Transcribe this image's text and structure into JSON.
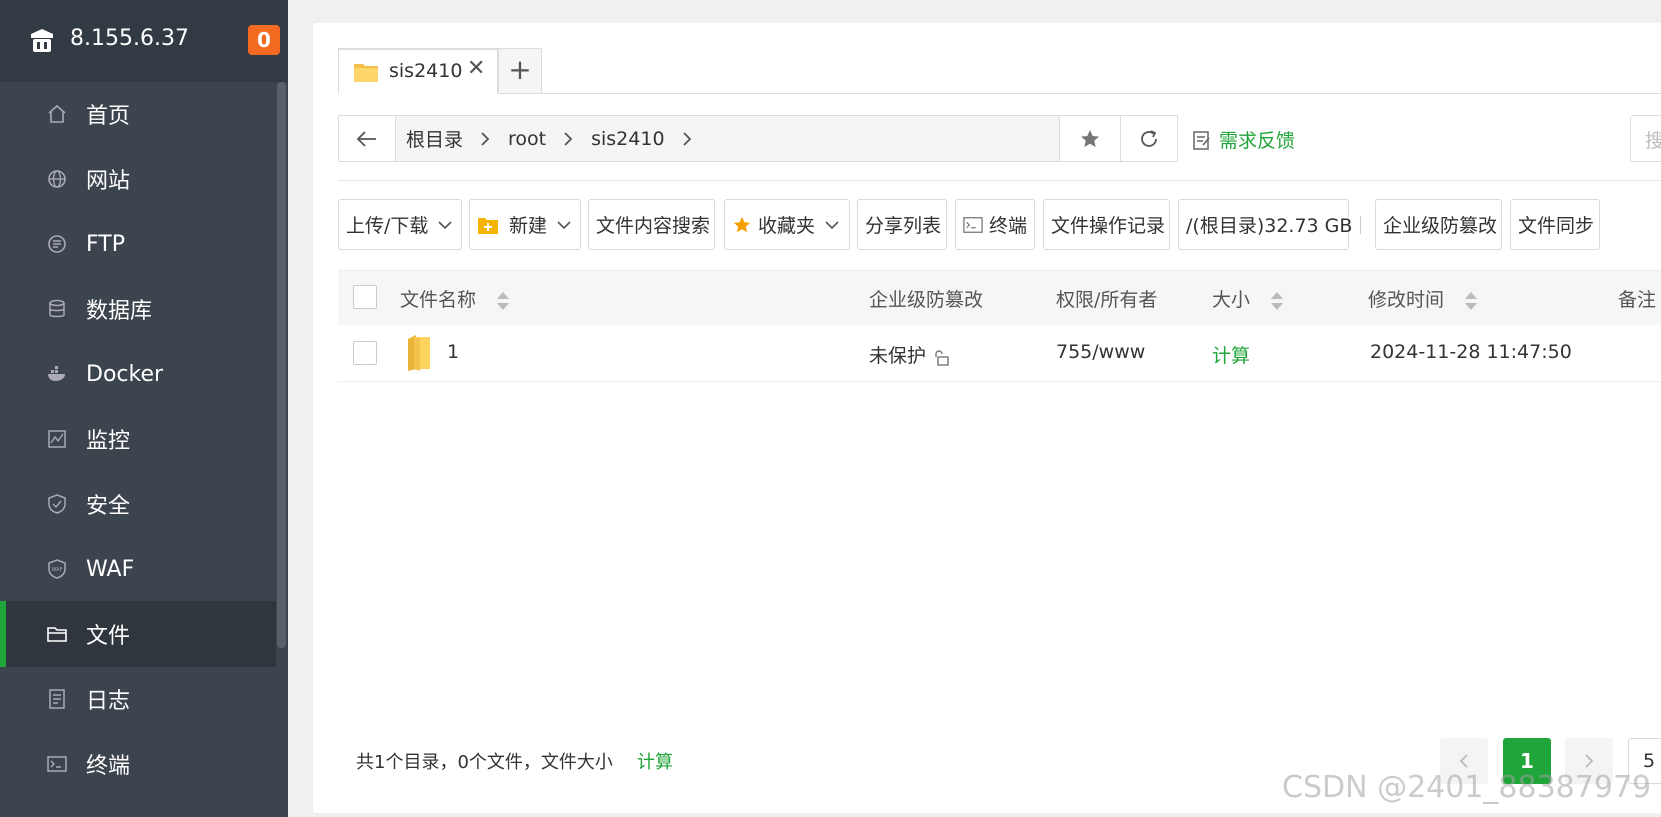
{
  "sidebar": {
    "server_ip": "8.155.6.37",
    "badge_count": "0",
    "items": [
      {
        "label": "首页",
        "icon": "home-icon"
      },
      {
        "label": "网站",
        "icon": "globe-icon"
      },
      {
        "label": "FTP",
        "icon": "ftp-icon"
      },
      {
        "label": "数据库",
        "icon": "database-icon"
      },
      {
        "label": "Docker",
        "icon": "docker-icon"
      },
      {
        "label": "监控",
        "icon": "monitor-icon"
      },
      {
        "label": "安全",
        "icon": "shield-icon"
      },
      {
        "label": "WAF",
        "icon": "waf-shield-icon"
      },
      {
        "label": "文件",
        "icon": "folder-icon",
        "active": true
      },
      {
        "label": "日志",
        "icon": "log-icon"
      },
      {
        "label": "终端",
        "icon": "terminal-icon"
      }
    ]
  },
  "tabs": [
    {
      "label": "sis2410"
    }
  ],
  "add_tab": "+",
  "path": {
    "crumbs": [
      "根目录",
      "root",
      "sis2410"
    ],
    "feedback": "需求反馈",
    "search_placeholder": "搜"
  },
  "toolbar": {
    "upload": "上传/下载",
    "new": "新建",
    "content_search": "文件内容搜索",
    "favorites": "收藏夹",
    "share_list": "分享列表",
    "terminal": "终端",
    "op_log": "文件操作记录",
    "disk": "/(根目录)32.73 GB",
    "tamper": "企业级防篡改",
    "sync": "文件同步"
  },
  "table": {
    "headers": {
      "name": "文件名称",
      "tamper": "企业级防篡改",
      "perm": "权限/所有者",
      "size": "大小",
      "mtime": "修改时间",
      "note": "备注"
    },
    "rows": [
      {
        "name": "1",
        "tamper": "未保护",
        "perm": "755/www",
        "size": "计算",
        "mtime": "2024-11-28 11:47:50"
      }
    ]
  },
  "footer": {
    "summary": "共1个目录，0个文件，文件大小",
    "calc": "计算",
    "current_page": "1",
    "page_size": "5"
  },
  "watermark": "CSDN @2401_88387979",
  "colors": {
    "accent": "#20a53a",
    "sidebar_bg": "#3c444d",
    "badge": "#f26b21"
  }
}
